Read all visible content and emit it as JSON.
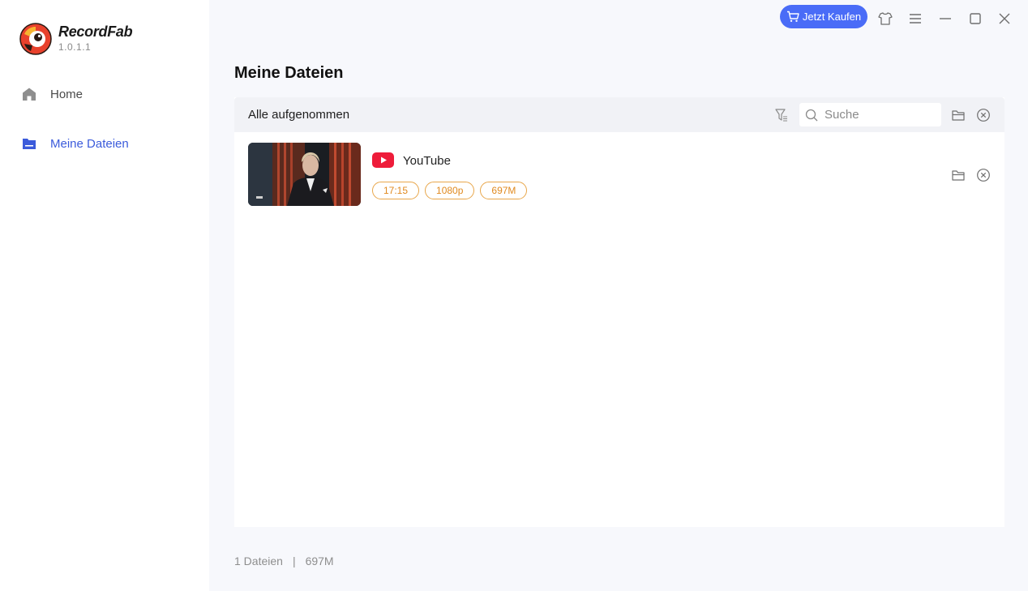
{
  "app": {
    "name": "RecordFab",
    "version": "1.0.1.1"
  },
  "sidebar": {
    "items": [
      {
        "label": "Home",
        "icon": "home-icon",
        "active": false
      },
      {
        "label": "Meine Dateien",
        "icon": "folder-icon",
        "active": true
      }
    ]
  },
  "titlebar": {
    "buy_label": "Jetzt Kaufen",
    "buy_icon": "cart-icon",
    "accent_color": "#4a6cf7"
  },
  "page": {
    "title": "Meine Dateien"
  },
  "toolbar": {
    "filter_label": "Alle aufgenommen",
    "search_placeholder": "Suche"
  },
  "files": [
    {
      "source": "YouTube",
      "duration": "17:15",
      "resolution": "1080p",
      "size": "697M"
    }
  ],
  "footer": {
    "count": "1 Dateien",
    "separator": "|",
    "total_size": "697M"
  }
}
